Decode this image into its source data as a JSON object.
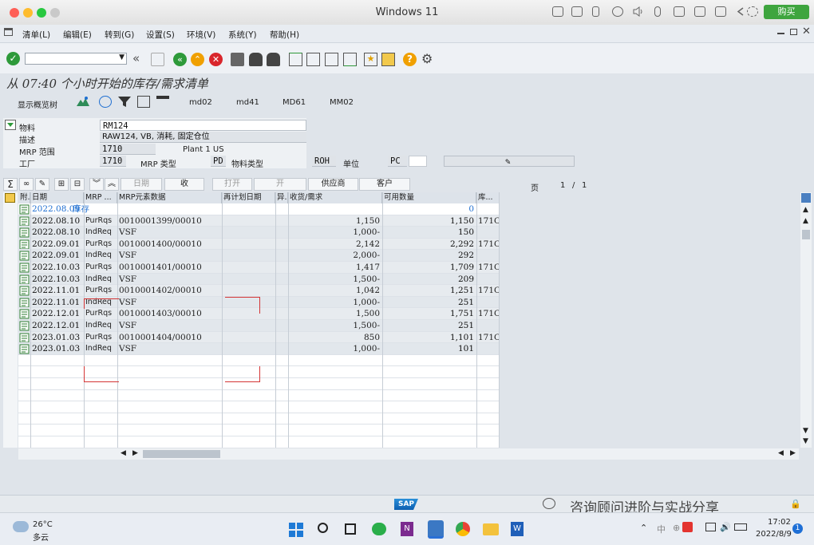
{
  "window": {
    "title": "Windows 11",
    "buy_label": "购买"
  },
  "menu": [
    "清单(L)",
    "编辑(E)",
    "转到(G)",
    "设置(S)",
    "环境(V)",
    "系统(Y)",
    "帮助(H)"
  ],
  "page_title": "从 07:40 个小时开始的库存/需求清单",
  "app_toolbar": {
    "overview_tree": "显示概览树",
    "btn1": "md02",
    "btn2": "md41",
    "btn3": "MD61",
    "btn4": "MM02"
  },
  "header": {
    "material_label": "物料",
    "material_value": "RM124",
    "desc_label": "描述",
    "desc_value": "RAW124, VB, 消耗, 固定仓位",
    "mrp_area_label": "MRP 范围",
    "mrp_area_value": "1710",
    "mrp_area_text": "Plant 1 US",
    "plant_label": "工厂",
    "plant_value": "1710",
    "mrp_type_label": "MRP 类型",
    "mrp_type_value": "PD",
    "mat_type_label": "物料类型",
    "mat_type_value": "ROH",
    "unit_label": "单位",
    "unit_value": "PC"
  },
  "grid_toolbar": {
    "date_btn": "日期",
    "receive_btn": "收",
    "replan_btn": "打开",
    "open_btn": "开",
    "vendor_btn": "供应商",
    "customer_btn": "客户",
    "page_label": "页",
    "page_current": "1",
    "page_sep": "/",
    "page_total": "1"
  },
  "columns": [
    "附.",
    "日期",
    "MRP ...",
    "MRP元素数据",
    "再计划日期",
    "异.",
    "收货/需求",
    "可用数量",
    "库..."
  ],
  "rows": [
    {
      "date": "2022.08.09",
      "elem": "库存",
      "data": "",
      "qty": "",
      "avail": "0",
      "stor": "",
      "stock": true
    },
    {
      "date": "2022.08.10",
      "elem": "PurRqs",
      "data": "0010001399/00010",
      "qty": "1,150",
      "avail": "1,150",
      "stor": "171C"
    },
    {
      "date": "2022.08.10",
      "elem": "IndReq",
      "data": "VSF",
      "qty": "1,000-",
      "avail": "150",
      "stor": ""
    },
    {
      "date": "2022.09.01",
      "elem": "PurRqs",
      "data": "0010001400/00010",
      "qty": "2,142",
      "avail": "2,292",
      "stor": "171C"
    },
    {
      "date": "2022.09.01",
      "elem": "IndReq",
      "data": "VSF",
      "qty": "2,000-",
      "avail": "292",
      "stor": ""
    },
    {
      "date": "2022.10.03",
      "elem": "PurRqs",
      "data": "0010001401/00010",
      "qty": "1,417",
      "avail": "1,709",
      "stor": "171C"
    },
    {
      "date": "2022.10.03",
      "elem": "IndReq",
      "data": "VSF",
      "qty": "1,500-",
      "avail": "209",
      "stor": ""
    },
    {
      "date": "2022.11.01",
      "elem": "PurRqs",
      "data": "0010001402/00010",
      "qty": "1,042",
      "avail": "1,251",
      "stor": "171C"
    },
    {
      "date": "2022.11.01",
      "elem": "IndReq",
      "data": "VSF",
      "qty": "1,000-",
      "avail": "251",
      "stor": ""
    },
    {
      "date": "2022.12.01",
      "elem": "PurRqs",
      "data": "0010001403/00010",
      "qty": "1,500",
      "avail": "1,751",
      "stor": "171C"
    },
    {
      "date": "2022.12.01",
      "elem": "IndReq",
      "data": "VSF",
      "qty": "1,500-",
      "avail": "251",
      "stor": ""
    },
    {
      "date": "2023.01.03",
      "elem": "PurRqs",
      "data": "0010001404/00010",
      "qty": "850",
      "avail": "1,101",
      "stor": "171C"
    },
    {
      "date": "2023.01.03",
      "elem": "IndReq",
      "data": "VSF",
      "qty": "1,000-",
      "avail": "101",
      "stor": ""
    }
  ],
  "status": {
    "sap_logo": "SAP",
    "watermark": "咨询顾问进阶与实战分享"
  },
  "taskbar": {
    "temp": "26°C",
    "weather": "多云",
    "time": "17:02",
    "date": "2022/8/9",
    "notif": "1"
  }
}
